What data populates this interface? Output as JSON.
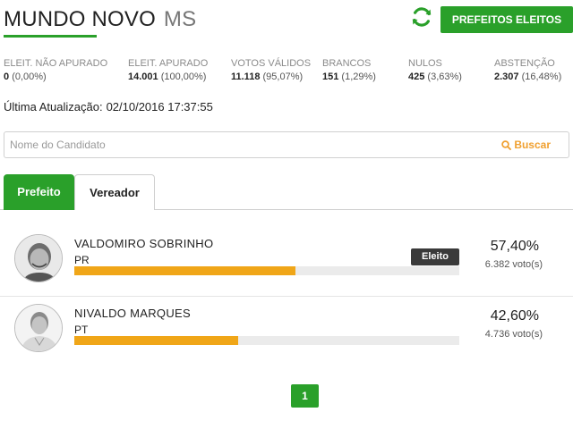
{
  "header": {
    "city": "MUNDO NOVO",
    "state": "MS",
    "refresh_icon": "refresh-icon",
    "prefeitos_button": "PREFEITOS ELEITOS",
    "accent_color": "#2aa02a"
  },
  "stats": [
    {
      "label": "ELEIT. NÃO APURADO",
      "value": "0",
      "pct": "(0,00%)"
    },
    {
      "label": "ELEIT. APURADO",
      "value": "14.001",
      "pct": "(100,00%)"
    },
    {
      "label": "VOTOS VÁLIDOS",
      "value": "11.118",
      "pct": "(95,07%)"
    },
    {
      "label": "BRANCOS",
      "value": "151",
      "pct": "(1,29%)"
    },
    {
      "label": "NULOS",
      "value": "425",
      "pct": "(3,63%)"
    },
    {
      "label": "ABSTENÇÃO",
      "value": "2.307",
      "pct": "(16,48%)"
    }
  ],
  "update": {
    "label": "Última Atualização:",
    "value": "02/10/2016 17:37:55"
  },
  "search": {
    "placeholder": "Nome do Candidato",
    "value": "",
    "button_label": "Buscar",
    "button_icon": "search-icon"
  },
  "tabs": [
    {
      "label": "Prefeito",
      "active": true
    },
    {
      "label": "Vereador",
      "active": false
    }
  ],
  "candidates": [
    {
      "name": "VALDOMIRO SOBRINHO",
      "party": "PR",
      "percent": "57,40%",
      "votes": "6.382 voto(s)",
      "share": 0.574,
      "badge": "Eleito"
    },
    {
      "name": "NIVALDO MARQUES",
      "party": "PT",
      "percent": "42,60%",
      "votes": "4.736 voto(s)",
      "share": 0.426
    }
  ],
  "bar_color": "#f0a618",
  "pagination": {
    "current": "1"
  }
}
